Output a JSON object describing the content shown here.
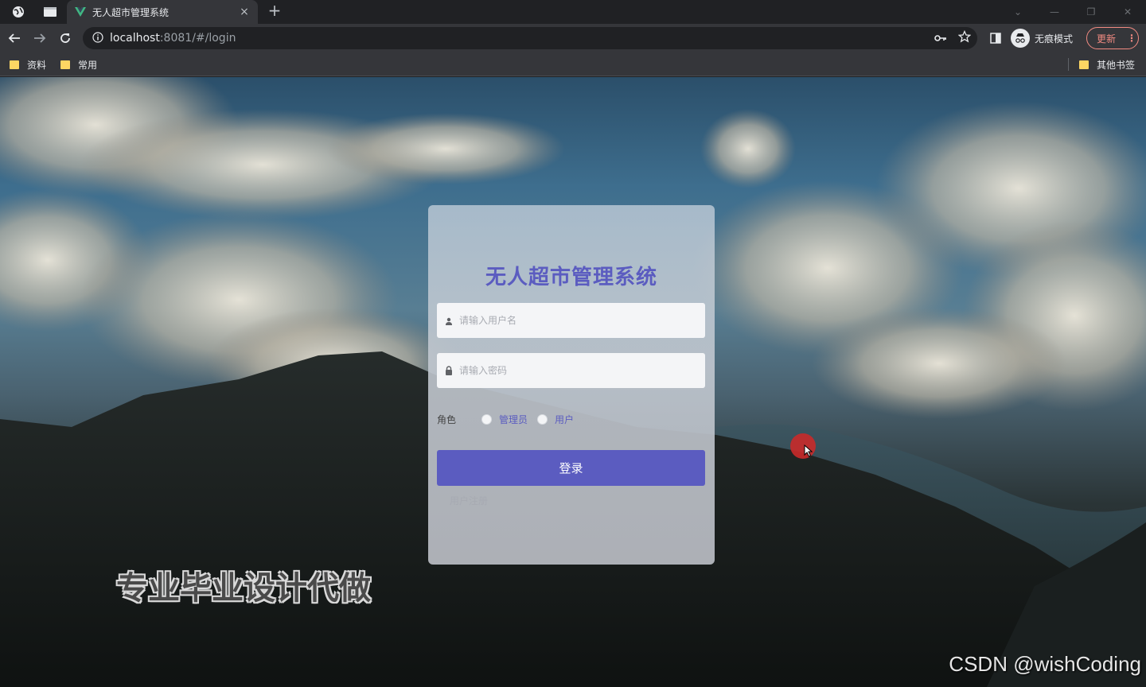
{
  "browser": {
    "tab_title": "无人超市管理系统",
    "tab_close": "×",
    "new_tab": "+",
    "url_host": "localhost",
    "url_rest": ":8081/#/login",
    "incognito_label": "无痕模式",
    "update_label": "更新",
    "update_menu": "⋮",
    "window_controls": [
      "⌄",
      "—",
      "❐",
      "✕"
    ],
    "bookmarks": [
      "资料",
      "常用"
    ],
    "other_bookmarks": "其他书签"
  },
  "login": {
    "title": "无人超市管理系统",
    "username_placeholder": "请输入用户名",
    "password_placeholder": "请输入密码",
    "role_label": "角色",
    "roles": [
      "管理员",
      "用户"
    ],
    "login_button": "登录",
    "register_link": "用户注册"
  },
  "overlays": {
    "promo_text": "专业毕业设计代做",
    "csdn_watermark": "CSDN @wishCoding"
  },
  "colors": {
    "accent": "#5b5cc0",
    "browser_dark": "#202124",
    "toolbar": "#35363a",
    "update_red": "#f28b82"
  },
  "icons": [
    "globe-icon",
    "tab-strip-icon",
    "vue-logo-icon",
    "back-icon",
    "forward-icon",
    "reload-icon",
    "info-icon",
    "key-icon",
    "star-icon",
    "side-panel-icon",
    "incognito-icon",
    "folder-icon",
    "user-icon",
    "lock-icon"
  ]
}
